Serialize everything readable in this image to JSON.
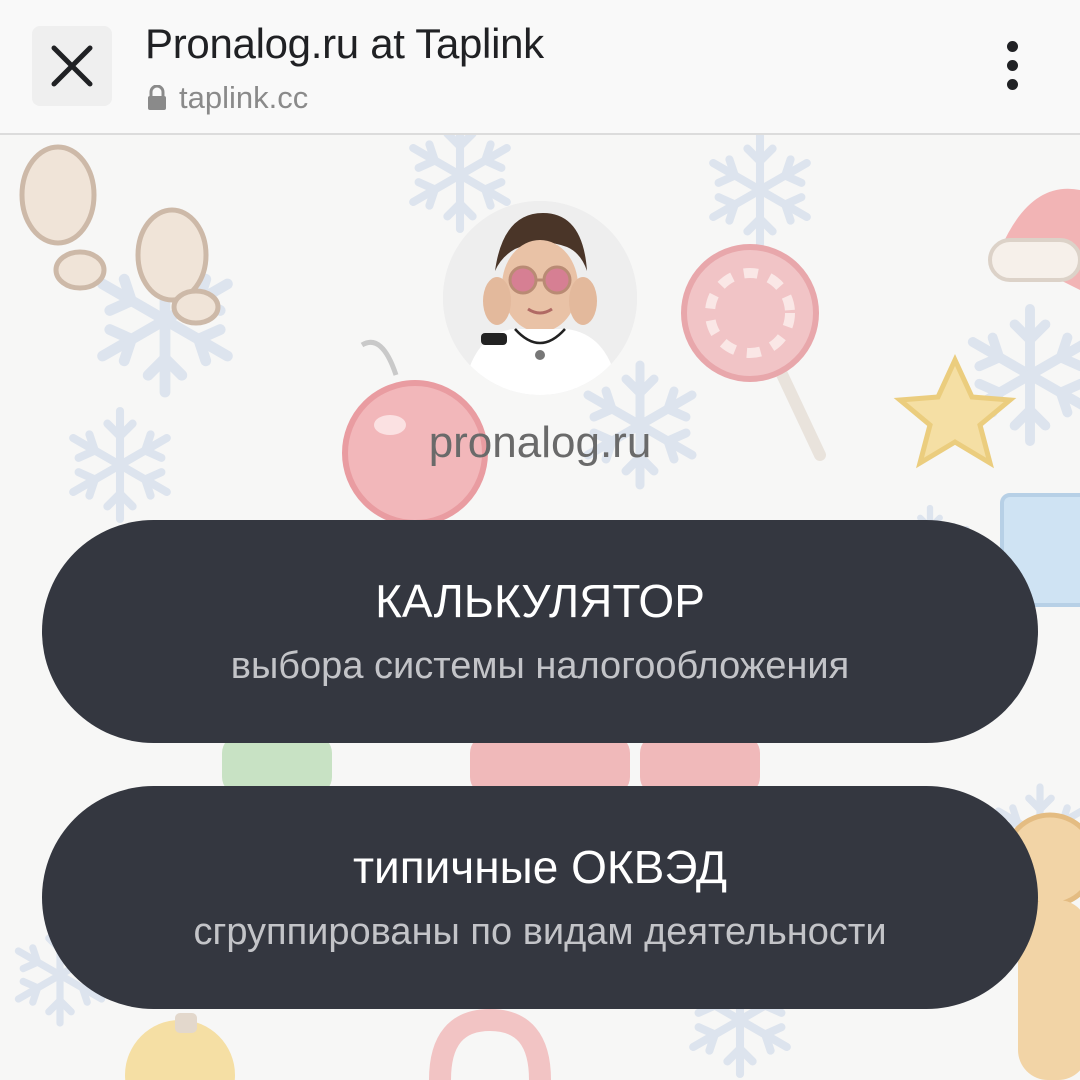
{
  "browser": {
    "title": "Pronalog.ru at Taplink",
    "url": "taplink.cc",
    "icons": {
      "close": "close-icon",
      "lock": "lock-icon",
      "menu": "more-vert-icon"
    }
  },
  "profile": {
    "name": "pronalog.ru",
    "avatar": "avatar-photo"
  },
  "buttons": [
    {
      "title": "КАЛЬКУЛЯТОР",
      "subtitle": "выбора системы налогообложения"
    },
    {
      "title": "типичные ОКВЭД",
      "subtitle": "сгруппированы по видам деятельности"
    }
  ],
  "colors": {
    "button_bg": "#343740",
    "button_text": "#ffffff",
    "button_subtext": "#c3c4c8",
    "page_bg": "#f7f7f6",
    "topbar_bg": "#f9f9f9"
  }
}
